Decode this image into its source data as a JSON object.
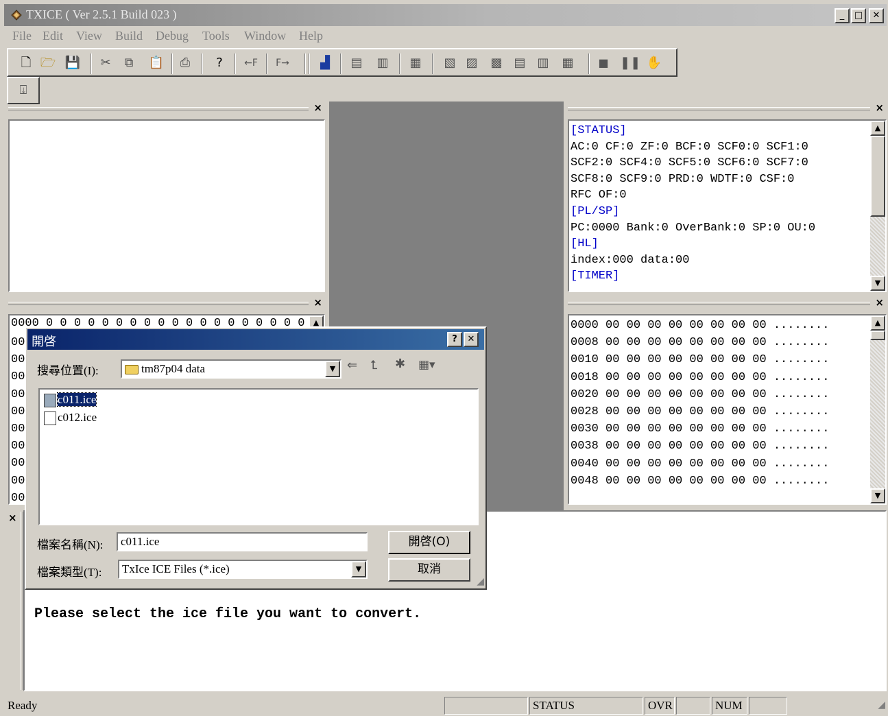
{
  "window": {
    "title": "TXICE ( Ver 2.5.1 Build 023 )",
    "controls": {
      "minimize": "_",
      "maximize": "□",
      "close": "✕"
    }
  },
  "menu": [
    "File",
    "Edit",
    "View",
    "Build",
    "Debug",
    "Tools",
    "Window",
    "Help"
  ],
  "toolbar": {
    "icons": [
      "new-file-icon",
      "open-folder-icon",
      "save-icon",
      "cut-icon",
      "copy-icon",
      "paste-icon",
      "print-icon",
      "help-icon",
      "step-back-icon",
      "step-forward-icon",
      "build-icon",
      "compile-icon",
      "compile-all-icon",
      "clean-icon",
      "breakpoint-icon",
      "run-to-cursor-icon",
      "step-into-icon",
      "step-over-icon",
      "step-out-icon",
      "reset-icon",
      "stop-icon",
      "pause-icon",
      "hand-icon"
    ],
    "step_back_label": "←F",
    "step_forward_label": "F→"
  },
  "registers": {
    "lines": [
      {
        "text": "[STATUS]",
        "head": true
      },
      {
        "text": "AC:0 CF:0 ZF:0 BCF:0 SCF0:0 SCF1:0",
        "head": false
      },
      {
        "text": "SCF2:0 SCF4:0 SCF5:0 SCF6:0 SCF7:0",
        "head": false
      },
      {
        "text": "SCF8:0 SCF9:0 PRD:0 WDTF:0 CSF:0",
        "head": false
      },
      {
        "text": "RFC OF:0",
        "head": false
      },
      {
        "text": "[PL/SP]",
        "head": true
      },
      {
        "text": "PC:0000 Bank:0 OverBank:0 SP:0 OU:0",
        "head": false
      },
      {
        "text": "[HL]",
        "head": true
      },
      {
        "text": "index:000 data:00",
        "head": false
      },
      {
        "text": "[TIMER]",
        "head": true
      }
    ]
  },
  "memory": {
    "rows": [
      "0000 00 00 00 00 00 00 00 00 ........",
      "0008 00 00 00 00 00 00 00 00 ........",
      "0010 00 00 00 00 00 00 00 00 ........",
      "0018 00 00 00 00 00 00 00 00 ........",
      "0020 00 00 00 00 00 00 00 00 ........",
      "0028 00 00 00 00 00 00 00 00 ........",
      "0030 00 00 00 00 00 00 00 00 ........",
      "0038 00 00 00 00 00 00 00 00 ........",
      "0040 00 00 00 00 00 00 00 00 ........",
      "0048 00 00 00 00 00 00 00 00 ........"
    ]
  },
  "data_pane": {
    "first_row": "0000 0 0 0 0 0 0 0 0 0 0 0 0 0 0 0 0 0 0 0 0",
    "row_prefixes": [
      "00",
      "00",
      "00",
      "00",
      "00",
      "00",
      "00",
      "00",
      "00",
      "00"
    ]
  },
  "open_dialog": {
    "title": "開啓",
    "help_button": "?",
    "close_button": "✕",
    "look_in_label": "搜尋位置(I):",
    "look_in_value": "tm87p04 data",
    "files": [
      {
        "name": "c011.ice",
        "selected": true
      },
      {
        "name": "c012.ice",
        "selected": false
      }
    ],
    "filename_label": "檔案名稱(N):",
    "filename_value": "c011.ice",
    "filetype_label": "檔案類型(T):",
    "filetype_value": "TxIce ICE Files (*.ice)",
    "open_button": "開啓(O)",
    "cancel_button": "取消"
  },
  "output": {
    "message": "Please select the ice file you want to convert."
  },
  "statusbar": {
    "ready": "Ready",
    "status": "STATUS",
    "ovr": "OVR",
    "num": "NUM"
  },
  "colors": {
    "register_header": "#0000c8",
    "dialog_title": "#0a246a",
    "selection": "#0a246a",
    "center_area": "#808080"
  }
}
